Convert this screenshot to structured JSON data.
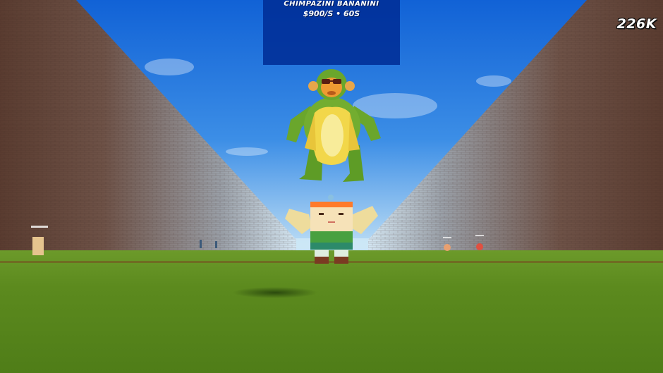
{
  "hud": {
    "currency": "226K"
  },
  "brainrot_info": {
    "name": "CHIMPAZINI BANANINI",
    "rate_and_time": "$900/S • 60S"
  },
  "colors": {
    "sky_top": "#1668d8",
    "sky_bottom": "#b8dcf4",
    "wall_brick": "#6a4436",
    "grass": "#5f8f1f",
    "panel_blue": "#002d96"
  }
}
